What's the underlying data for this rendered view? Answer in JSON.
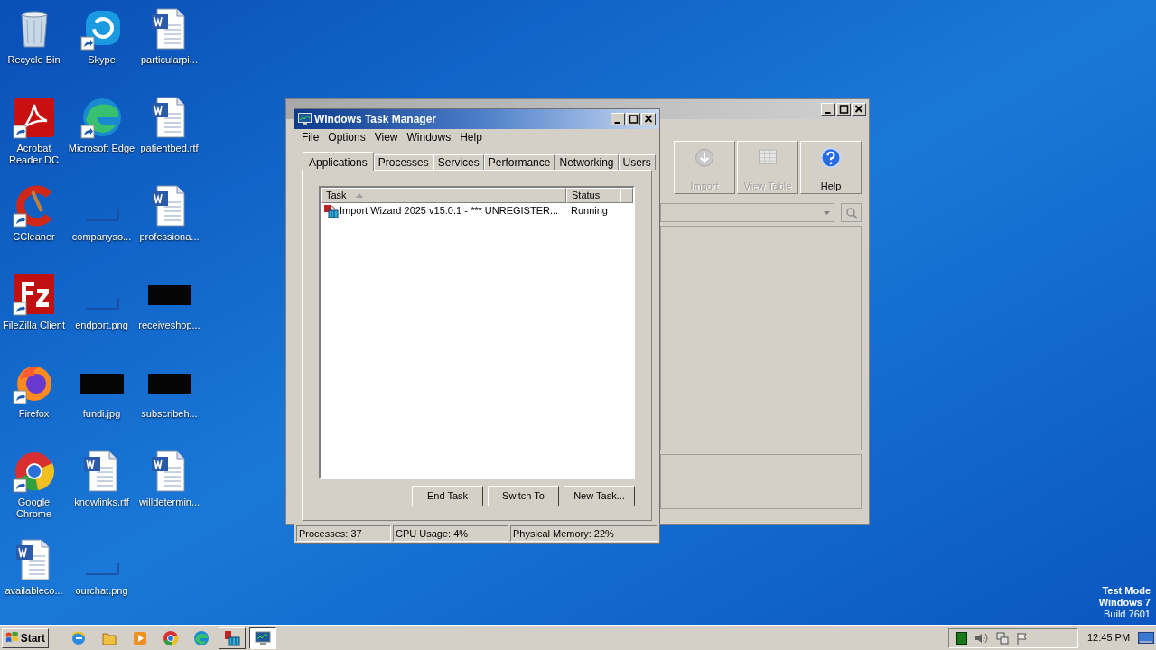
{
  "desktop_icons": [
    {
      "label": "Recycle Bin",
      "kind": "bin",
      "shortcut": false
    },
    {
      "label": "Skype",
      "kind": "skype",
      "shortcut": true
    },
    {
      "label": "particularpi...",
      "kind": "doc",
      "shortcut": false
    },
    {
      "label": "Acrobat Reader DC",
      "kind": "acrobat",
      "shortcut": true
    },
    {
      "label": "Microsoft Edge",
      "kind": "edge",
      "shortcut": true
    },
    {
      "label": "patientbed.rtf",
      "kind": "doc",
      "shortcut": false
    },
    {
      "label": "CCleaner",
      "kind": "ccleaner",
      "shortcut": true
    },
    {
      "label": "companyso...",
      "kind": "blank",
      "shortcut": false
    },
    {
      "label": "professiona...",
      "kind": "doc",
      "shortcut": false
    },
    {
      "label": "FileZilla Client",
      "kind": "filezilla",
      "shortcut": true
    },
    {
      "label": "endport.png",
      "kind": "blank",
      "shortcut": false
    },
    {
      "label": "receiveshop...",
      "kind": "dark",
      "shortcut": false
    },
    {
      "label": "Firefox",
      "kind": "firefox",
      "shortcut": true
    },
    {
      "label": "fundi.jpg",
      "kind": "dark",
      "shortcut": false
    },
    {
      "label": "subscribeh...",
      "kind": "dark",
      "shortcut": false
    },
    {
      "label": "Google Chrome",
      "kind": "chrome",
      "shortcut": true
    },
    {
      "label": "knowlinks.rtf",
      "kind": "doc",
      "shortcut": false
    },
    {
      "label": "willdetermin...",
      "kind": "doc",
      "shortcut": false
    },
    {
      "label": "availableco...",
      "kind": "doc",
      "shortcut": false
    },
    {
      "label": "ourchat.png",
      "kind": "blank",
      "shortcut": false
    }
  ],
  "background_window": {
    "toolbar": [
      {
        "label": "Import",
        "kind": "import",
        "disabled": true
      },
      {
        "label": "View Table",
        "kind": "table",
        "disabled": true
      },
      {
        "label": "Help",
        "kind": "help",
        "disabled": false
      }
    ]
  },
  "task_manager": {
    "title": "Windows Task Manager",
    "menu": [
      "File",
      "Options",
      "View",
      "Windows",
      "Help"
    ],
    "tabs": [
      {
        "label": "Applications",
        "selected": true
      },
      {
        "label": "Processes",
        "selected": false
      },
      {
        "label": "Services",
        "selected": false
      },
      {
        "label": "Performance",
        "selected": false
      },
      {
        "label": "Networking",
        "selected": false
      },
      {
        "label": "Users",
        "selected": false
      }
    ],
    "table": {
      "columns": [
        "Task",
        "Status"
      ],
      "rows": [
        {
          "task": "Import Wizard 2025 v15.0.1 - *** UNREGISTER...",
          "status": "Running"
        }
      ]
    },
    "buttons": [
      "End Task",
      "Switch To",
      "New Task..."
    ],
    "status_bar": [
      "Processes: 37",
      "CPU Usage: 4%",
      "Physical Memory: 22%"
    ]
  },
  "desktop_notice": [
    "Test Mode",
    "Windows 7",
    "Build 7601"
  ],
  "taskbar": {
    "start": "Start",
    "items": [
      {
        "kind": "ie",
        "selected": false
      },
      {
        "kind": "folder",
        "selected": false
      },
      {
        "kind": "media",
        "selected": false
      },
      {
        "kind": "chrome",
        "selected": false
      },
      {
        "kind": "edge",
        "selected": false
      },
      {
        "kind": "wizard",
        "selected": false
      },
      {
        "kind": "monitor",
        "selected": true
      }
    ],
    "clock": "12:45 PM"
  }
}
